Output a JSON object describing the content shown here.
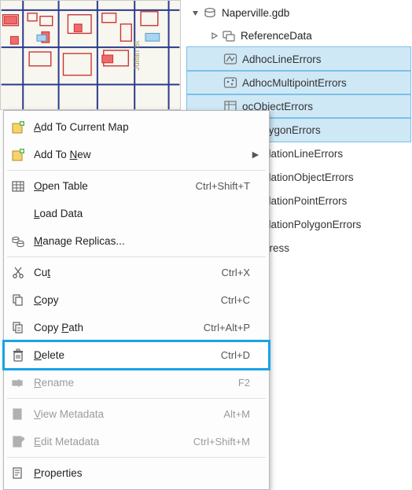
{
  "tree": {
    "root": {
      "label": "Naperville.gdb"
    },
    "dataset": {
      "label": "ReferenceData"
    },
    "items": [
      {
        "label": "AdhocLineErrors",
        "selected": true
      },
      {
        "label": "AdhocMultipointErrors",
        "selected": true
      },
      {
        "label": "AdhocObjectErrors",
        "selected": true,
        "clipped": "ocObjectErrors"
      },
      {
        "label": "AdhocPolygonErrors",
        "selected": true,
        "clipped": "ocPolygonErrors"
      },
      {
        "label": "GDB_ValidationLineErrors",
        "selected": false,
        "clipped": "_ValidationLineErrors"
      },
      {
        "label": "GDB_ValidationObjectErrors",
        "selected": false,
        "clipped": "_ValidationObjectErrors"
      },
      {
        "label": "GDB_ValidationPointErrors",
        "selected": false,
        "clipped": "_ValidationPointErrors"
      },
      {
        "label": "GDB_ValidationPolygonErrors",
        "selected": false,
        "clipped": "_ValidationPolygonErrors"
      },
      {
        "label": "PostalAddress",
        "selected": false,
        "clipped": "alAddress"
      }
    ]
  },
  "menu": {
    "add_current": {
      "pre": "",
      "accel": "A",
      "post": "dd To Current Map",
      "shortcut": "",
      "sub": false
    },
    "add_new": {
      "pre": "Add To ",
      "accel": "N",
      "post": "ew",
      "shortcut": "",
      "sub": true
    },
    "open_table": {
      "pre": "",
      "accel": "O",
      "post": "pen Table",
      "shortcut": "Ctrl+Shift+T"
    },
    "load_data": {
      "pre": "",
      "accel": "L",
      "post": "oad Data",
      "shortcut": ""
    },
    "manage_rep": {
      "pre": "",
      "accel": "M",
      "post": "anage Replicas...",
      "shortcut": ""
    },
    "cut": {
      "pre": "Cu",
      "accel": "t",
      "post": "",
      "shortcut": "Ctrl+X"
    },
    "copy": {
      "pre": "",
      "accel": "C",
      "post": "opy",
      "shortcut": "Ctrl+C"
    },
    "copy_path": {
      "pre": "Copy ",
      "accel": "P",
      "post": "ath",
      "shortcut": "Ctrl+Alt+P"
    },
    "delete": {
      "pre": "",
      "accel": "D",
      "post": "elete",
      "shortcut": "Ctrl+D"
    },
    "rename": {
      "pre": "",
      "accel": "R",
      "post": "ename",
      "shortcut": "F2",
      "disabled": true
    },
    "view_meta": {
      "pre": "",
      "accel": "V",
      "post": "iew Metadata",
      "shortcut": "Alt+M",
      "disabled": true
    },
    "edit_meta": {
      "pre": "",
      "accel": "E",
      "post": "dit Metadata",
      "shortcut": "Ctrl+Shift+M",
      "disabled": true
    },
    "properties": {
      "pre": "",
      "accel": "P",
      "post": "roperties",
      "shortcut": ""
    }
  }
}
